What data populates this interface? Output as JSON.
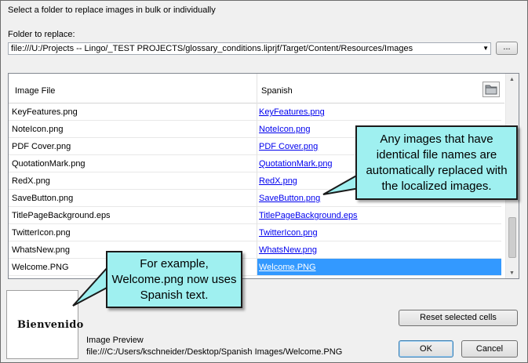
{
  "instruction": "Select a folder to replace images in bulk or individually",
  "folder_label": "Folder to replace:",
  "folder_path": "file:///U:/Projects -- Lingo/_TEST PROJECTS/glossary_conditions.liprjf/Target/Content/Resources/Images",
  "browse_label": "...",
  "table": {
    "columns": [
      "Image File",
      "Spanish"
    ],
    "rows": [
      {
        "file": "KeyFeatures.png",
        "spanish": "KeyFeatures.png"
      },
      {
        "file": "NoteIcon.png",
        "spanish": "NoteIcon.png"
      },
      {
        "file": "PDF Cover.png",
        "spanish": "PDF Cover.png"
      },
      {
        "file": "QuotationMark.png",
        "spanish": "QuotationMark.png"
      },
      {
        "file": "RedX.png",
        "spanish": "RedX.png"
      },
      {
        "file": "SaveButton.png",
        "spanish": "SaveButton.png"
      },
      {
        "file": "TitlePageBackground.eps",
        "spanish": "TitlePageBackground.eps"
      },
      {
        "file": "TwitterIcon.png",
        "spanish": "TwitterIcon.png"
      },
      {
        "file": "WhatsNew.png",
        "spanish": "WhatsNew.png"
      },
      {
        "file": "Welcome.PNG",
        "spanish": "Welcome.PNG",
        "selected": true
      }
    ]
  },
  "preview": {
    "image_text": "Bienvenido",
    "label": "Image Preview",
    "path": "file:///C:/Users/kschneider/Desktop/Spanish Images/Welcome.PNG"
  },
  "buttons": {
    "reset": "Reset selected cells",
    "ok": "OK",
    "cancel": "Cancel"
  },
  "callouts": {
    "identical_names": "Any images that have identical file names are automatically replaced with the localized images.",
    "example": "For example, Welcome.png now uses Spanish text."
  },
  "colors": {
    "selection": "#3399ff",
    "link": "#0000ee",
    "callout_fill": "#9ff0f0"
  }
}
